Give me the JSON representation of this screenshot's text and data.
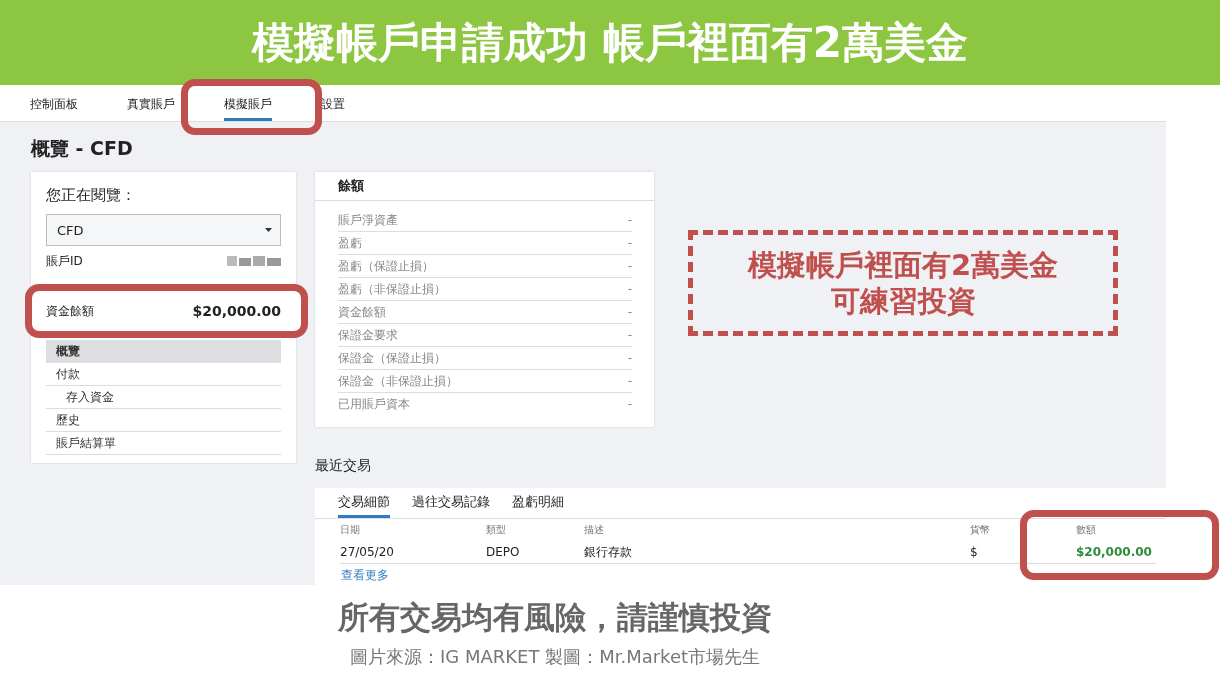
{
  "banner": {
    "title": "模擬帳戶申請成功 帳戶裡面有2萬美金"
  },
  "nav": {
    "tabs": [
      {
        "label": "控制面板",
        "selected": false
      },
      {
        "label": "真實賬戶",
        "selected": false
      },
      {
        "label": "模擬賬戶",
        "selected": true
      },
      {
        "label": "設置",
        "selected": false
      }
    ]
  },
  "page_title": "概覽 - CFD",
  "account_panel": {
    "heading": "您正在閱覽：",
    "account_select": {
      "value": "CFD"
    },
    "account_id_label": "賬戶ID",
    "menu": [
      {
        "label": "概覽",
        "selected": true
      },
      {
        "label": "付款",
        "selected": false,
        "children": [
          {
            "label": "存入資金",
            "selected": false
          }
        ]
      },
      {
        "label": "歷史",
        "selected": false
      },
      {
        "label": "賬戶結算單",
        "selected": false
      }
    ]
  },
  "highlight_callout": {
    "label": "資金餘額",
    "value": "$20,000.00"
  },
  "balance": {
    "title": "餘額",
    "rows": [
      {
        "label": "賬戶淨資產",
        "value": "-"
      },
      {
        "label": "盈虧",
        "value": "-"
      },
      {
        "label": "盈虧（保證止損）",
        "value": "-"
      },
      {
        "label": "盈虧（非保證止損）",
        "value": "-"
      },
      {
        "label": "資金餘額",
        "value": "-"
      },
      {
        "label": "保證金要求",
        "value": "-"
      },
      {
        "label": "保證金（保證止損）",
        "value": "-"
      },
      {
        "label": "保證金（非保證止損）",
        "value": "-"
      },
      {
        "label": "已用賬戶資本",
        "value": "-"
      }
    ]
  },
  "note": {
    "lines": [
      "模擬帳戶裡面有2萬美金",
      "可練習投資"
    ]
  },
  "recent": {
    "title": "最近交易",
    "tabs": [
      {
        "label": "交易細節",
        "selected": true
      },
      {
        "label": "過往交易記錄",
        "selected": false
      },
      {
        "label": "盈虧明細",
        "selected": false
      }
    ],
    "columns": [
      "日期",
      "類型",
      "描述",
      "貨幣",
      "數額"
    ],
    "rows": [
      {
        "cells": [
          "27/05/20",
          "DEPO",
          "銀行存款",
          "$",
          "$20,000.00"
        ]
      }
    ],
    "more_link": "查看更多"
  },
  "footer": {
    "warning": "所有交易均有風險，請謹慎投資",
    "source": "圖片來源：IG MARKET 製圖：Mr.Market市場先生"
  }
}
